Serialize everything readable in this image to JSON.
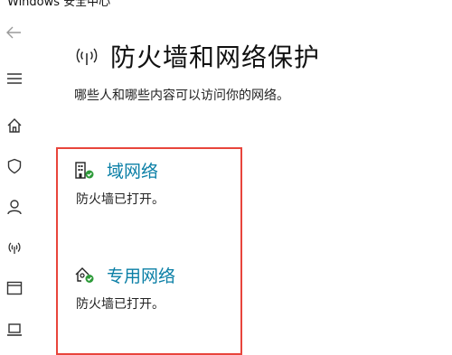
{
  "app": {
    "title": "Windows 安全中心"
  },
  "nav": {
    "back_icon": "back-arrow-icon",
    "items": [
      {
        "icon": "hamburger-menu-icon"
      },
      {
        "icon": "home-icon"
      },
      {
        "icon": "shield-icon"
      },
      {
        "icon": "account-icon"
      },
      {
        "icon": "network-wireless-icon"
      },
      {
        "icon": "app-browser-icon"
      },
      {
        "icon": "device-laptop-icon"
      }
    ]
  },
  "main": {
    "title": "防火墙和网络保护",
    "subtitle": "哪些人和哪些内容可以访问你的网络。",
    "networks": [
      {
        "name": "域网络",
        "status": "防火墙已打开。",
        "icon": "domain-network-icon"
      },
      {
        "name": "专用网络",
        "status": "防火墙已打开。",
        "icon": "private-network-icon"
      }
    ]
  },
  "colors": {
    "accent": "#0a7fa6",
    "ok_green": "#2e9b3a",
    "highlight": "#e8453c"
  }
}
